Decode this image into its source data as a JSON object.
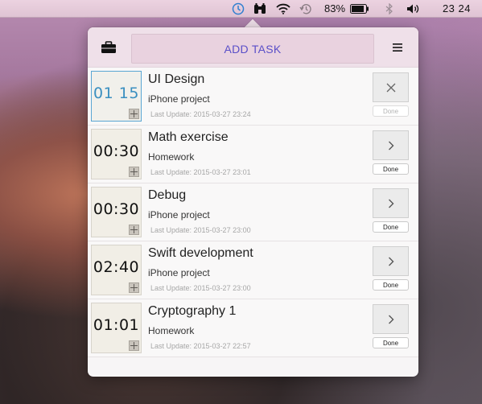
{
  "menubar": {
    "battery_percent": "83%",
    "time": "23 24",
    "icons": [
      "clock-icon",
      "binoculars-icon",
      "wifi-icon",
      "time-machine-icon",
      "battery-icon",
      "bluetooth-icon",
      "volume-icon"
    ]
  },
  "popover": {
    "add_task_label": "ADD TASK",
    "tasks": [
      {
        "timer": "01 15",
        "title": "UI Design",
        "project": "iPhone project",
        "updated": "Last Update: 2015-03-27 23:24",
        "action_icon": "close-icon",
        "done_label": "Done",
        "active": true
      },
      {
        "timer": "00:30",
        "title": "Math exercise",
        "project": "Homework",
        "updated": "Last Update: 2015-03-27 23:01",
        "action_icon": "chevron-right-icon",
        "done_label": "Done",
        "active": false
      },
      {
        "timer": "00:30",
        "title": "Debug",
        "project": "iPhone project",
        "updated": "Last Update: 2015-03-27 23:00",
        "action_icon": "chevron-right-icon",
        "done_label": "Done",
        "active": false
      },
      {
        "timer": "02:40",
        "title": "Swift development",
        "project": "iPhone project",
        "updated": "Last Update: 2015-03-27 23:00",
        "action_icon": "chevron-right-icon",
        "done_label": "Done",
        "active": false
      },
      {
        "timer": "01:01",
        "title": "Cryptography 1",
        "project": "Homework",
        "updated": "Last Update: 2015-03-27 22:57",
        "action_icon": "chevron-right-icon",
        "done_label": "Done",
        "active": false
      }
    ]
  },
  "colors": {
    "accent_purple": "#5a4fc8",
    "active_timer_blue": "#3a8fc0",
    "header_pink": "#efe0e9"
  }
}
